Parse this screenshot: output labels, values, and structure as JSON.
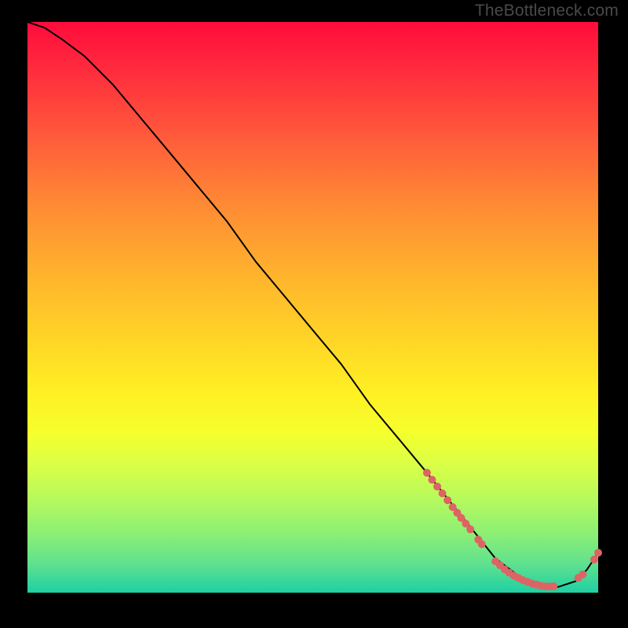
{
  "watermark": "TheBottleneck.com",
  "colors": {
    "background": "#000000",
    "dot": "#dd6464",
    "curve": "#000000",
    "text": "#4a4a4a"
  },
  "chart_data": {
    "type": "line",
    "title": "",
    "xlabel": "",
    "ylabel": "",
    "xlim": [
      0,
      100
    ],
    "ylim": [
      0,
      100
    ],
    "grid": false,
    "legend": false,
    "series": [
      {
        "name": "bottleneck-curve",
        "x": [
          0,
          3,
          6,
          10,
          15,
          20,
          25,
          30,
          35,
          40,
          45,
          50,
          55,
          60,
          65,
          70,
          74,
          78,
          82,
          86,
          90,
          93,
          96,
          98,
          100
        ],
        "y": [
          100,
          99,
          97,
          94,
          89,
          83,
          77,
          71,
          65,
          58,
          52,
          46,
          40,
          33,
          27,
          21,
          16,
          11,
          6,
          3,
          1,
          1,
          2,
          4,
          7
        ]
      }
    ],
    "dots": {
      "name": "highlighted-points",
      "segments": [
        {
          "comment": "upper diagonal cluster",
          "x": [
            70.0,
            70.9,
            71.8,
            72.7,
            73.6,
            74.5,
            75.3,
            76.0,
            76.8,
            77.6
          ],
          "y": [
            21.0,
            19.8,
            18.6,
            17.4,
            16.2,
            15.0,
            14.0,
            13.1,
            12.1,
            11.1
          ]
        },
        {
          "comment": "small mid-gap pair",
          "x": [
            79.0,
            79.6
          ],
          "y": [
            9.3,
            8.5
          ]
        },
        {
          "comment": "bottom flat run",
          "x": [
            82.0,
            82.8,
            83.6,
            84.4,
            85.2,
            86.0,
            86.8,
            87.6,
            88.4,
            89.2,
            90.0,
            90.8,
            91.5,
            92.2
          ],
          "y": [
            5.5,
            4.8,
            4.1,
            3.5,
            3.0,
            2.6,
            2.2,
            1.9,
            1.6,
            1.4,
            1.2,
            1.1,
            1.1,
            1.1
          ]
        },
        {
          "comment": "rising tail pair",
          "x": [
            96.5,
            97.3
          ],
          "y": [
            2.6,
            3.2
          ]
        },
        {
          "comment": "end pair",
          "x": [
            99.3,
            100.0
          ],
          "y": [
            5.8,
            7.0
          ]
        }
      ]
    }
  }
}
